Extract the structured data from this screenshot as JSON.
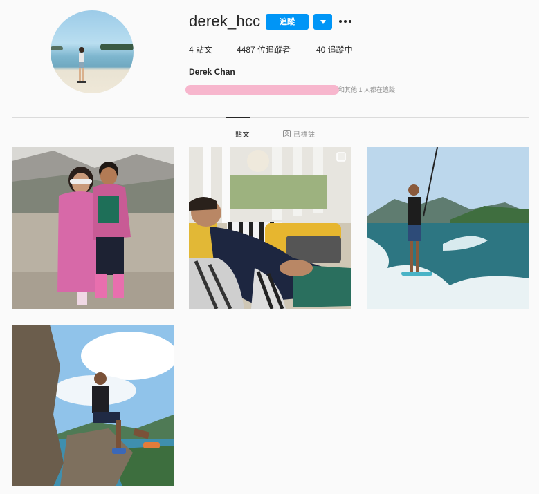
{
  "profile": {
    "username": "derek_hcc",
    "follow_label": "追蹤",
    "full_name": "Derek Chan",
    "followed_by_text": "和其他 1 人都在追蹤"
  },
  "stats": {
    "posts": "4 貼文",
    "followers": "4487 位追蹤者",
    "following": "40 追蹤中"
  },
  "tabs": [
    {
      "label": "貼文",
      "icon": "grid-icon",
      "active": true
    },
    {
      "label": "已標註",
      "icon": "tagged-icon",
      "active": false
    }
  ],
  "posts": [
    {
      "subject": "two-children-pink-jackets",
      "multi": false
    },
    {
      "subject": "man-reclining-on-sofa",
      "multi": true
    },
    {
      "subject": "wakesurfing",
      "multi": false
    },
    {
      "subject": "man-sitting-on-rock",
      "multi": false
    }
  ],
  "colors": {
    "accent": "#0095f6",
    "background": "#fafafa",
    "redaction": "#f7b6cd"
  }
}
